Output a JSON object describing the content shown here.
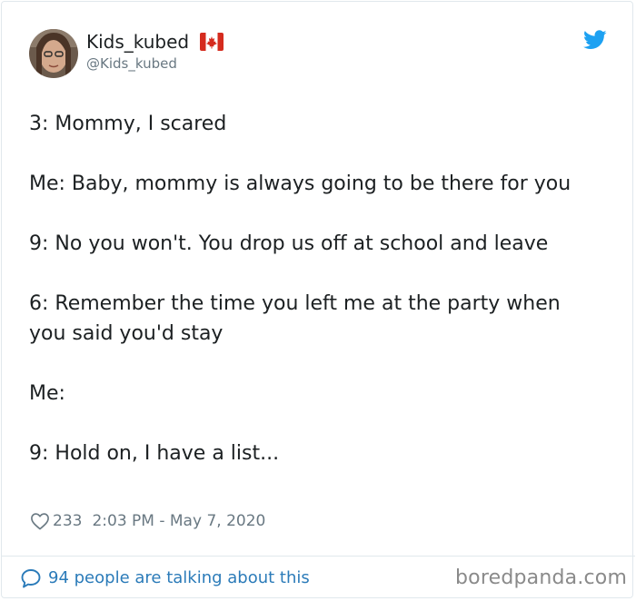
{
  "author": {
    "display_name": "Kids_kubed",
    "handle": "@Kids_kubed",
    "avatar": "user-avatar-photo",
    "flag": "canada-flag-icon"
  },
  "brand_icon": "twitter-bird-icon",
  "tweet": {
    "text": "3: Mommy, I scared\n\nMe: Baby, mommy is always going to be there for you\n\n9: No you won't. You drop us off at school and leave\n\n6: Remember the time you left me at the party when you said you'd stay\n\nMe:\n\n9: Hold on, I have a list..."
  },
  "meta": {
    "likes": "233",
    "timestamp": "2:03 PM - May 7, 2020",
    "like_icon": "heart-icon"
  },
  "footer": {
    "talking": "94 people are talking about this",
    "talking_icon": "speech-bubble-icon"
  },
  "watermark": "boredpanda.com",
  "colors": {
    "twitter_blue": "#1da1f2",
    "link_blue": "#2b7bb9",
    "text": "#1c2022",
    "secondary_text": "#697882",
    "border": "#e1e8ed"
  }
}
